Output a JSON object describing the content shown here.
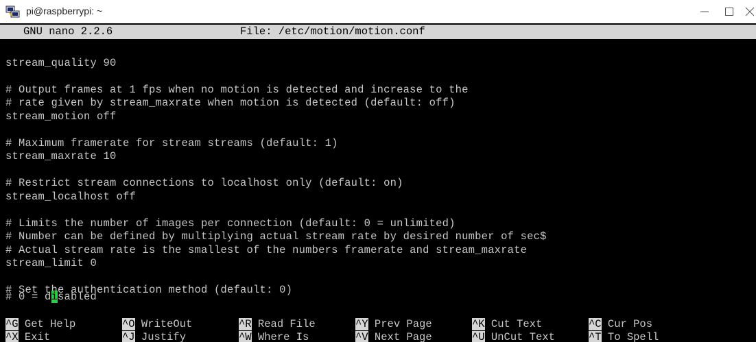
{
  "window": {
    "title": "pi@raspberrypi: ~",
    "icon": "putty-icon"
  },
  "nano": {
    "version": "GNU nano 2.2.6",
    "file_label": "File: /etc/motion/motion.conf"
  },
  "content_lines": [
    "",
    "stream_quality 90",
    "",
    "# Output frames at 1 fps when no motion is detected and increase to the",
    "# rate given by stream_maxrate when motion is detected (default: off)",
    "stream_motion off",
    "",
    "# Maximum framerate for stream streams (default: 1)",
    "stream_maxrate 10",
    "",
    "# Restrict stream connections to localhost only (default: on)",
    "stream_localhost off",
    "",
    "# Limits the number of images per connection (default: 0 = unlimited)",
    "# Number can be defined by multiplying actual stream rate by desired number of sec$",
    "# Actual stream rate is the smallest of the numbers framerate and stream_maxrate",
    "stream_limit 0",
    "",
    "# Set the authentication method (default: 0)"
  ],
  "cursor_line": {
    "before": "# 0 = d",
    "cursor_char": "i",
    "after": "sabled"
  },
  "shortcuts": {
    "row1": [
      {
        "key": "^G",
        "label": "Get Help"
      },
      {
        "key": "^O",
        "label": "WriteOut"
      },
      {
        "key": "^R",
        "label": "Read File"
      },
      {
        "key": "^Y",
        "label": "Prev Page"
      },
      {
        "key": "^K",
        "label": "Cut Text"
      },
      {
        "key": "^C",
        "label": "Cur Pos"
      }
    ],
    "row2": [
      {
        "key": "^X",
        "label": "Exit"
      },
      {
        "key": "^J",
        "label": "Justify"
      },
      {
        "key": "^W",
        "label": "Where Is"
      },
      {
        "key": "^V",
        "label": "Next Page"
      },
      {
        "key": "^U",
        "label": "UnCut Text"
      },
      {
        "key": "^T",
        "label": "To Spell"
      }
    ]
  },
  "colors": {
    "terminal_bg": "#000000",
    "terminal_fg": "#c8c8c8",
    "inverse_bg": "#d6d6d6",
    "cursor": "#2ecc40"
  }
}
